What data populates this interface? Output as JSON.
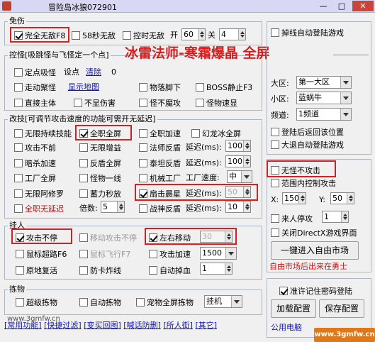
{
  "window": {
    "title": "冒险岛冰狼072901",
    "min": "—",
    "max": "□",
    "close": "✕"
  },
  "headline": "冰雷法师-寒霜爆晶 全屏",
  "g1": {
    "title": "免伤",
    "full": "完全无敌F8",
    "s58": "58秒无敌",
    "ctrl": "控时无敌",
    "open": "开",
    "open_val": "60",
    "close": "关",
    "close_val": "4"
  },
  "g2": {
    "title": "控怪[吸跳怪与飞怪定一个点]",
    "fixed": "定点吸怪",
    "setpt": "设点",
    "clearpt": "清除",
    "ptval": "0",
    "walk": "走动聚怪",
    "showmap": "显示地图",
    "drop": "物落脚下",
    "boss": "BOSS静止F3",
    "direct": "直接主体",
    "noharm": "不显伤害",
    "nomagic": "怪不魔攻",
    "speed": "怪物速显"
  },
  "g3": {
    "title": "改技[可调节攻击速度的功能可需开无延迟]",
    "r1": [
      "无限持续技能",
      "全职全屏",
      "全职加速",
      "幻龙冰全屏"
    ],
    "r2": [
      "攻击不前",
      "无限增益",
      "法师反盾",
      "延迟(ms):"
    ],
    "d1": "100",
    "r3": [
      "暗杀加速",
      "反盾全屏",
      "泰坦反盾",
      "延迟(ms):"
    ],
    "d2": "100",
    "r4": [
      "工厂全屏",
      "怪物一线",
      "机械工厂",
      "工厂速度:"
    ],
    "speedval": "中",
    "r5": [
      "无限阿修罗",
      "蓄力秒放",
      "扇击晨星",
      "延迟(ms):"
    ],
    "d3": "50",
    "r6": [
      "全职无延迟",
      "倍数:",
      "战神反盾",
      "延迟(ms):"
    ],
    "mult": "5",
    "d4": "10"
  },
  "g4": {
    "title": "挂人",
    "atk": "攻击不停",
    "moveatk": "移动攻击不停",
    "lr": "左右移动",
    "lrval": "30",
    "mouse": "鼠标超路F6",
    "mousefly": "鼠标飞行F7",
    "atkspd": "攻击加速",
    "atkval": "1500",
    "resurrect": "原地复活",
    "anti": "防卡炸线",
    "autodrop": "自动掉血",
    "dropval": "1"
  },
  "g5": {
    "title": "拣物",
    "super": "超级拣物",
    "auto": "自动拣物",
    "pet": "宠物全屏拣物",
    "mode": "挂机"
  },
  "footer": [
    "[常用功能]",
    "[快捷过滤]",
    "[变买回图]",
    "[喊话防删]",
    "[所人街]",
    "[其它]"
  ],
  "website": "www.3gmfw.cn",
  "right": {
    "dc": "掉线自动登陆游戏",
    "region_l": "大区:",
    "region": "第一大区",
    "sub_l": "小区:",
    "sub": "蓝蜗牛",
    "ch_l": "频道:",
    "ch": "1频道",
    "restore": "登陆后返回该位置",
    "bigret": "大退自动登陆游戏",
    "nokill": "无怪不攻击",
    "range": "范围内控制攻击",
    "x_l": "X:",
    "x": "150",
    "y_l": "Y:",
    "y": "50",
    "visitor": "来人停攻",
    "visval": "1",
    "closedx": "关闭DirectX游戏界面",
    "market": "一键进入自由市场",
    "market_note": "自由市场后出来在勇士",
    "remember": "准许记住密码登陆",
    "load": "加载配置",
    "save": "保存配置",
    "pubpc": "公用电脑",
    "wm": "www.3gmfw.cn"
  }
}
